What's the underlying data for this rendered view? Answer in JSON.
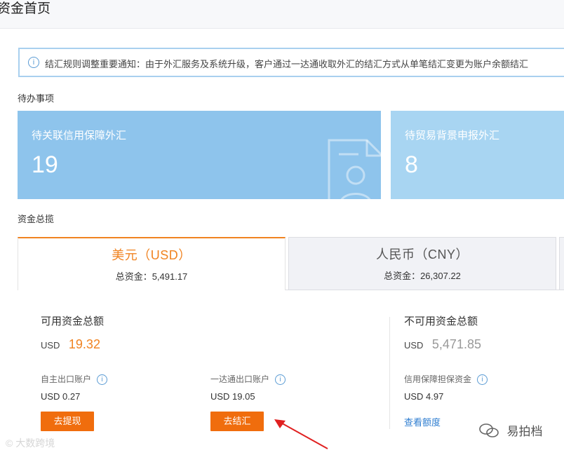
{
  "header": {
    "title": "资金首页"
  },
  "notice": {
    "text": "结汇规则调整重要通知：由于外汇服务及系统升级，客户通过一达通收取外汇的结汇方式从单笔结汇变更为账户余额结汇"
  },
  "todo": {
    "label": "待办事项",
    "cards": [
      {
        "title": "待关联信用保障外汇",
        "count": "19"
      },
      {
        "title": "待贸易背景申报外汇",
        "count": "8"
      }
    ]
  },
  "funds": {
    "label": "资金总揽",
    "tabs": [
      {
        "currency": "美元（USD）",
        "total": "总资金：5,491.17"
      },
      {
        "currency": "人民币（CNY）",
        "total": "总资金：26,307.22"
      }
    ],
    "available": {
      "title": "可用资金总额",
      "unit": "USD",
      "amount": "19.32",
      "accounts": [
        {
          "label": "自主出口账户",
          "value": "USD 0.27",
          "button": "去提现"
        },
        {
          "label": "一达通出口账户",
          "value": "USD 19.05",
          "button": "去结汇"
        }
      ]
    },
    "unavailable": {
      "title": "不可用资金总额",
      "unit": "USD",
      "amount": "5,471.85",
      "sub_label": "信用保障担保资金",
      "sub_value": "USD 4.97",
      "link": "查看额度"
    }
  },
  "watermarks": {
    "left": "大数跨境",
    "right": "易拍档"
  },
  "colors": {
    "accent": "#f08321",
    "button": "#f06d0d",
    "card": "#8ec4ec",
    "link": "#2e7dd0"
  }
}
